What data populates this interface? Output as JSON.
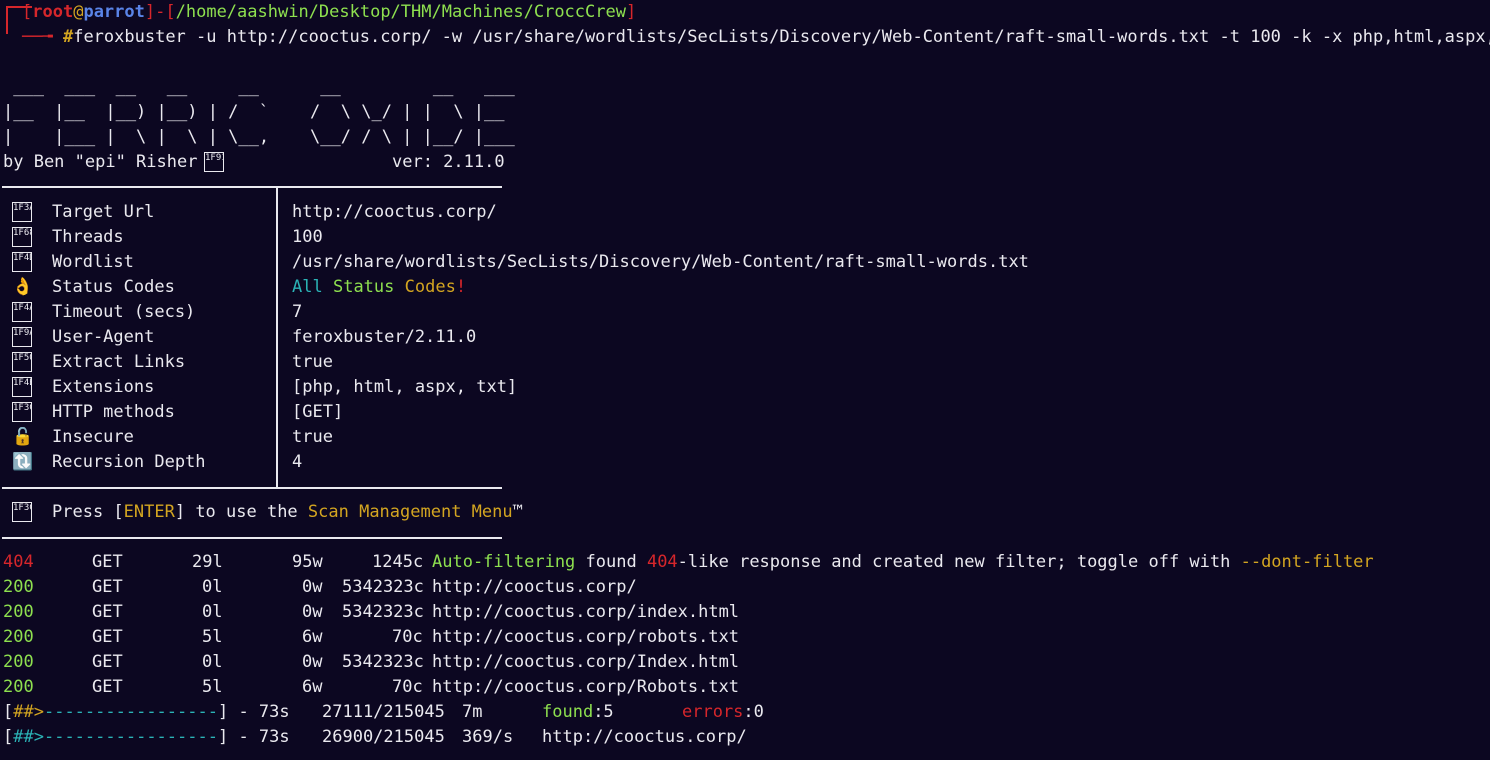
{
  "prompt": {
    "open_bracket": "[",
    "user": "root",
    "at": "@",
    "host": "parrot",
    "close_bracket": "]",
    "dash": "-",
    "path_open": "[",
    "path": "/home/aashwin/Desktop/THM/Machines/CroccCrew",
    "path_close": "]",
    "symbol": "#",
    "command": "feroxbuster -u http://cooctus.corp/ -w /usr/share/wordlists/SecLists/Discovery/Web-Content/raft-small-words.txt -t 100 -k -x php,html,aspx,txt"
  },
  "banner": {
    "art": [
      " ___  ___  __   __     __      __         __   ___",
      "|__  |__  |__) |__) | /  `    /  \\ \\_/ | |  \\ |__",
      "|    |___ |  \\ |  \\ | \\__,    \\__/ / \\ | |__/ |___"
    ],
    "author": "by Ben \"epi\" Risher",
    "author_icon": "1F913",
    "version": "ver: 2.11.0"
  },
  "config": [
    {
      "icon": "1F3AF",
      "label": "Target Url",
      "value": "http://cooctus.corp/"
    },
    {
      "icon": "1F680",
      "label": "Threads",
      "value": "100"
    },
    {
      "icon": "1F4D6",
      "label": "Wordlist",
      "value": "/usr/share/wordlists/SecLists/Discovery/Web-Content/raft-small-words.txt"
    },
    {
      "icon": "👌",
      "label": "Status Codes",
      "value": ""
    },
    {
      "icon": "1F4A5",
      "label": "Timeout (secs)",
      "value": "7"
    },
    {
      "icon": "1F9A1",
      "label": "User-Agent",
      "value": "feroxbuster/2.11.0"
    },
    {
      "icon": "1F50E",
      "label": "Extract Links",
      "value": "true"
    },
    {
      "icon": "1F4B2",
      "label": "Extensions",
      "value": "[php, html, aspx, txt]"
    },
    {
      "icon": "1F3C1",
      "label": "HTTP methods",
      "value": "[GET]"
    },
    {
      "icon": "🔓",
      "label": "Insecure",
      "value": "true"
    },
    {
      "icon": "🔃",
      "label": "Recursion Depth",
      "value": "4"
    }
  ],
  "status_codes_value": {
    "part1": "All",
    "part2": "Status",
    "part3": "Codes",
    "part4": "!"
  },
  "menu_hint": {
    "icon": "1F3C1",
    "press": "Press [",
    "enter": "ENTER",
    "to_use": "] to use the ",
    "menu": "Scan Management Menu",
    "tm": "™"
  },
  "results": [
    {
      "status": "404",
      "method": "GET",
      "lines": "29l",
      "words": "95w",
      "chars": "1245c",
      "url": ""
    },
    {
      "status": "200",
      "method": "GET",
      "lines": "0l",
      "words": "0w",
      "chars": "5342323c",
      "url": "http://cooctus.corp/"
    },
    {
      "status": "200",
      "method": "GET",
      "lines": "0l",
      "words": "0w",
      "chars": "5342323c",
      "url": "http://cooctus.corp/index.html"
    },
    {
      "status": "200",
      "method": "GET",
      "lines": "5l",
      "words": "6w",
      "chars": "70c",
      "url": "http://cooctus.corp/robots.txt"
    },
    {
      "status": "200",
      "method": "GET",
      "lines": "0l",
      "words": "0w",
      "chars": "5342323c",
      "url": "http://cooctus.corp/Index.html"
    },
    {
      "status": "200",
      "method": "GET",
      "lines": "5l",
      "words": "6w",
      "chars": "70c",
      "url": "http://cooctus.corp/Robots.txt"
    }
  ],
  "autofilter": {
    "a": "Auto-filtering",
    "b": " found ",
    "c": "404",
    "d": "-like response and created new filter; toggle off with ",
    "e": "--dont-filter"
  },
  "progress": [
    {
      "open": "[",
      "arrow": "##>",
      "bar": "-----------------",
      "close": "]",
      "elapsed": " - 73s",
      "count": "27111/215045",
      "rate": "7m",
      "found_label": "found",
      "found_value": ":5",
      "errors_label": "errors",
      "errors_value": ":0"
    },
    {
      "open": "[",
      "arrow": "##>",
      "bar": "-----------------",
      "close": "]",
      "elapsed": " - 73s",
      "count": "26900/215045",
      "rate": "369/s",
      "target": "http://cooctus.corp/"
    }
  ],
  "colors": {
    "background": "#0c0721",
    "red": "#d6262b",
    "green": "#8ee04f",
    "cyan": "#2bb3b6",
    "yellow": "#d3a521",
    "blue": "#5a84e8",
    "text": "#eae9ef"
  }
}
